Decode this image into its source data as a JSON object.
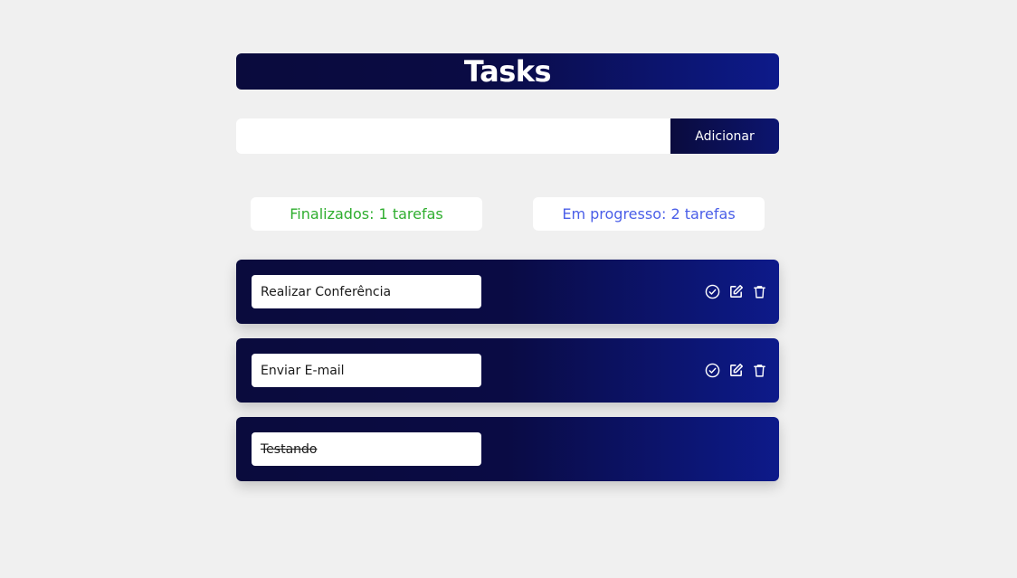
{
  "header": {
    "title": "Tasks"
  },
  "add_form": {
    "input_value": "",
    "input_placeholder": "",
    "button_label": "Adicionar"
  },
  "counters": {
    "done_label": "Finalizados: 1 tarefas",
    "progress_label": "Em progresso: 2 tarefas"
  },
  "tasks": [
    {
      "text": "Realizar Conferência",
      "completed": false,
      "actions": [
        "check-icon",
        "edit-icon",
        "trash-icon"
      ]
    },
    {
      "text": "Enviar E-mail",
      "completed": false,
      "actions": [
        "check-icon",
        "edit-icon",
        "trash-icon"
      ]
    },
    {
      "text": "Testando",
      "completed": true,
      "actions": []
    }
  ],
  "colors": {
    "background": "#f0f0f0",
    "primary_dark": "#0a0b3d",
    "primary_blue": "#0d1a8a",
    "done_green": "#2fae2f",
    "progress_blue": "#4a5ee8"
  }
}
